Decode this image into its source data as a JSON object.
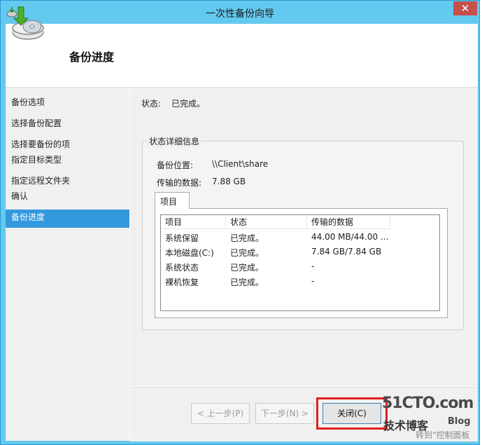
{
  "window": {
    "title": "一次性备份向导",
    "close_glyph": "✕"
  },
  "header": {
    "title": "备份进度"
  },
  "sidebar": {
    "items": [
      {
        "label": "备份选项"
      },
      {
        "label": "选择备份配置"
      },
      {
        "label": "选择要备份的项"
      },
      {
        "label": "指定目标类型"
      },
      {
        "label": "指定远程文件夹"
      },
      {
        "label": "确认"
      },
      {
        "label": "备份进度"
      }
    ]
  },
  "status": {
    "label": "状态:",
    "value": "已完成。"
  },
  "details": {
    "group_label": "状态详细信息",
    "location_label": "备份位置:",
    "location_value": "\\\\Client\\share",
    "transferred_label": "传输的数据:",
    "transferred_value": "7.88 GB",
    "tab_label": "项目"
  },
  "table": {
    "headers": [
      "项目",
      "状态",
      "传输的数据"
    ],
    "rows": [
      [
        "系统保留",
        "已完成。",
        "44.00 MB/44.00 ..."
      ],
      [
        "本地磁盘(C:)",
        "已完成。",
        "7.84 GB/7.84 GB"
      ],
      [
        "系统状态",
        "已完成。",
        "-"
      ],
      [
        "裸机恢复",
        "已完成。",
        "-"
      ]
    ]
  },
  "buttons": {
    "prev": "< 上一步(P)",
    "next": "下一步(N) >",
    "close": "关闭(C)"
  },
  "watermark": {
    "site": "51CTO.com",
    "line1": "技术博客",
    "blog": "Blog",
    "line2": "转到\"控制面板"
  },
  "colors": {
    "titlebar": "#64c9ee",
    "selection": "#3399dd",
    "highlight": "#e02020"
  }
}
